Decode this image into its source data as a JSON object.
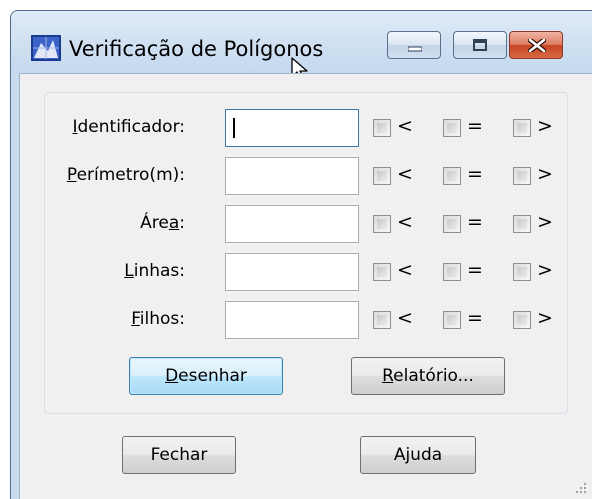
{
  "window": {
    "title": "Verificação de Polígonos",
    "controls": {
      "minimize": "minimize",
      "maximize": "maximize",
      "close": "close"
    }
  },
  "form": {
    "rows": [
      {
        "label_key": "I",
        "label_rest": "dentificador:",
        "value": "",
        "focused": true
      },
      {
        "label_key": "P",
        "label_rest": "erímetro(m):",
        "value": ""
      },
      {
        "label_pre": "Áre",
        "label_key": "a",
        "label_post": ":",
        "value": ""
      },
      {
        "label_key": "L",
        "label_rest": "inhas:",
        "value": ""
      },
      {
        "label_key": "F",
        "label_rest": "ilhos:",
        "value": ""
      }
    ],
    "operators": {
      "lt": "<",
      "eq": "=",
      "gt": ">"
    }
  },
  "buttons": {
    "draw": {
      "key": "D",
      "rest": "esenhar"
    },
    "report": {
      "key": "R",
      "rest": "elatório..."
    },
    "close": "Fechar",
    "help": "Ajuda"
  },
  "icons": [
    "app-icon",
    "minimize-icon",
    "maximize-icon",
    "close-icon",
    "resize-grip-icon"
  ]
}
